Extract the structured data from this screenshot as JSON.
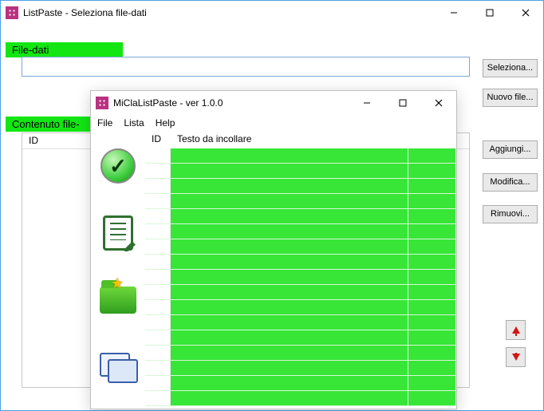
{
  "mainWindow": {
    "title": "ListPaste - Seleziona file-dati",
    "section_file_label": "File-dati",
    "file_input_value": "",
    "section_content_label": "Contenuto file-",
    "list_column_id": "ID",
    "buttons": {
      "seleziona": "Seleziona...",
      "nuovo": "Nuovo file...",
      "aggiungi": "Aggiungi...",
      "modifica": "Modifica...",
      "rimuovi": "Rimuovi..."
    }
  },
  "childWindow": {
    "title": "MiClaListPaste - ver 1.0.0",
    "menu": {
      "file": "File",
      "lista": "Lista",
      "help": "Help"
    },
    "grid": {
      "col_id": "ID",
      "col_text": "Testo da incollare",
      "row_count": 17
    },
    "tool_icons": {
      "confirm": "check-circle-icon",
      "edit_doc": "document-edit-icon",
      "open_folder": "folder-star-icon",
      "cards": "id-cards-icon"
    }
  }
}
